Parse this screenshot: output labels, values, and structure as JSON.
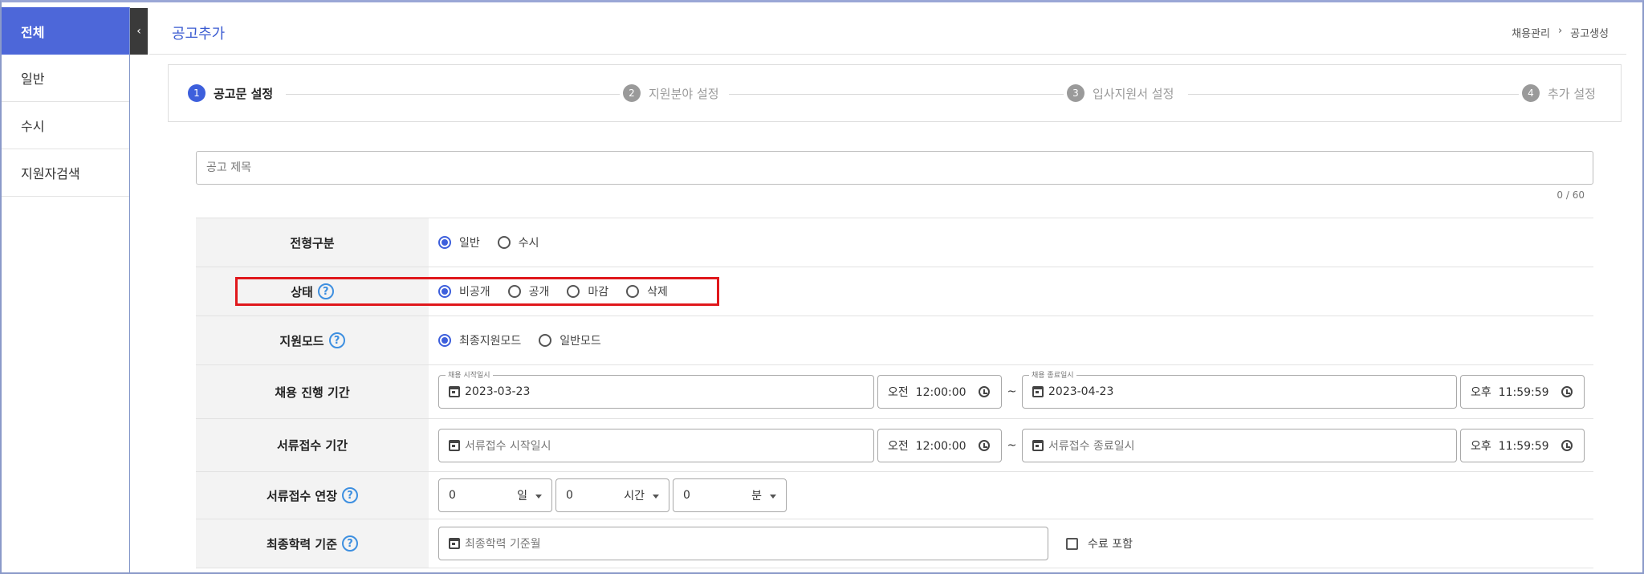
{
  "sidebar": {
    "collapse_icon": "‹",
    "items": [
      {
        "label": "전체",
        "active": true
      },
      {
        "label": "일반",
        "active": false
      },
      {
        "label": "수시",
        "active": false
      },
      {
        "label": "지원자검색",
        "active": false
      }
    ]
  },
  "header": {
    "title": "공고추가",
    "breadcrumb": [
      "채용관리",
      "›",
      "공고생성"
    ]
  },
  "stepper": {
    "steps": [
      {
        "num": "1",
        "label": "공고문 설정",
        "active": true
      },
      {
        "num": "2",
        "label": "지원분야 설정",
        "active": false
      },
      {
        "num": "3",
        "label": "입사지원서 설정",
        "active": false
      },
      {
        "num": "4",
        "label": "추가 설정",
        "active": false
      }
    ]
  },
  "title_field": {
    "placeholder": "공고 제목",
    "value": "",
    "counter": "0 / 60"
  },
  "form": {
    "type": {
      "label": "전형구분",
      "options": [
        "일반",
        "수시"
      ],
      "selected": "일반"
    },
    "status": {
      "label": "상태",
      "help": "?",
      "options": [
        "비공개",
        "공개",
        "마감",
        "삭제"
      ],
      "selected": "비공개"
    },
    "apply_mode": {
      "label": "지원모드",
      "help": "?",
      "options": [
        "최종지원모드",
        "일반모드"
      ],
      "selected": "최종지원모드"
    },
    "hiring_period": {
      "label": "채용 진행 기간",
      "start_legend": "채용 시작일시",
      "start_date": "2023-03-23",
      "start_time": "오전  12:00:00",
      "tilde": "~",
      "end_legend": "채용 종료일시",
      "end_date": "2023-04-23",
      "end_time": "오후  11:59:59"
    },
    "document_period": {
      "label": "서류접수 기간",
      "start_placeholder": "서류접수 시작일시",
      "start_time": "오전  12:00:00",
      "tilde": "~",
      "end_placeholder": "서류접수 종료일시",
      "end_time": "오후  11:59:59"
    },
    "extension": {
      "label": "서류접수 연장",
      "help": "?",
      "days": {
        "value": "0",
        "unit": "일"
      },
      "hours": {
        "value": "0",
        "unit": "시간"
      },
      "minutes": {
        "value": "0",
        "unit": "분"
      }
    },
    "education": {
      "label": "최종학력 기준",
      "help": "?",
      "placeholder": "최종학력 기준월",
      "checkbox_label": "수료 포함",
      "checkbox_checked": false
    }
  },
  "colors": {
    "accent": "#3d5fdc",
    "sidebar_active": "#4d67d9",
    "highlight": "#e0181c"
  }
}
